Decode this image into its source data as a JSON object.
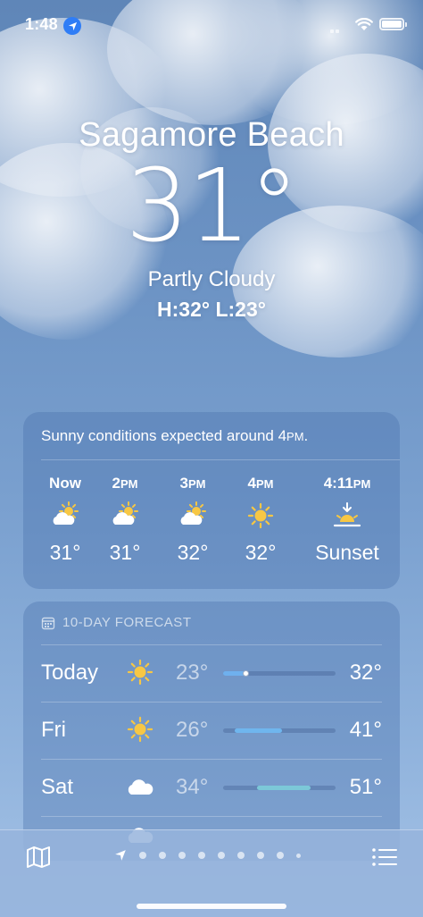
{
  "status_bar": {
    "time": "1:48"
  },
  "location": {
    "city": "Sagamore Beach",
    "temperature": "31°",
    "condition": "Partly Cloudy",
    "high_low": "H:32°  L:23°"
  },
  "hourly": {
    "message_prefix": "Sunny conditions expected around 4",
    "message_suffix": "PM",
    "message_end": ".",
    "items": [
      {
        "label": "Now",
        "suffix": "",
        "icon": "partly-sunny-icon",
        "temp": "31°"
      },
      {
        "label": "2",
        "suffix": "PM",
        "icon": "partly-sunny-icon",
        "temp": "31°"
      },
      {
        "label": "3",
        "suffix": "PM",
        "icon": "partly-sunny-icon",
        "temp": "32°"
      },
      {
        "label": "4",
        "suffix": "PM",
        "icon": "sun-icon",
        "temp": "32°"
      },
      {
        "label": "4:11",
        "suffix": "PM",
        "icon": "sunset-icon",
        "temp": "Sunset"
      }
    ]
  },
  "daily": {
    "header": "10-DAY FORECAST",
    "items": [
      {
        "day": "Today",
        "icon": "sun-icon",
        "low": "23°",
        "high": "32°",
        "range_start": 0.0,
        "range_end": 0.2,
        "current": 0.2,
        "bar_color": "#6fb0ee"
      },
      {
        "day": "Fri",
        "icon": "sun-icon",
        "low": "26°",
        "high": "41°",
        "range_start": 0.1,
        "range_end": 0.52,
        "bar_color": "#6fb6ee"
      },
      {
        "day": "Sat",
        "icon": "cloud-icon",
        "low": "34°",
        "high": "51°",
        "range_start": 0.3,
        "range_end": 0.78,
        "bar_color": "#7cc8d8"
      }
    ]
  },
  "colors": {
    "sun": "#f7c744",
    "accent_blue": "#2f7df6"
  }
}
